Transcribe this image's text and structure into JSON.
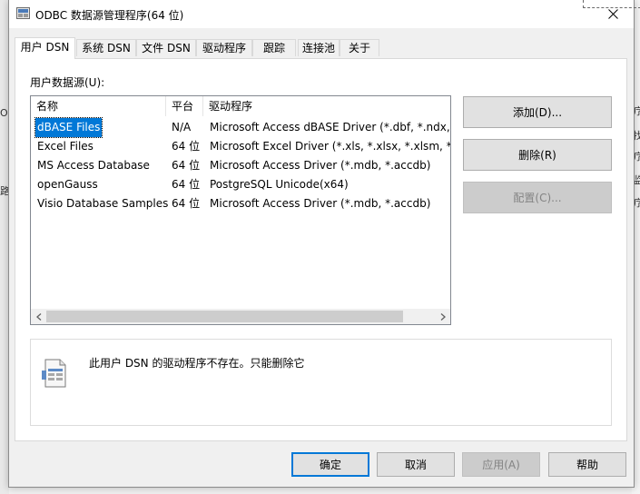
{
  "window": {
    "title": "ODBC 数据源管理程序(64 位)"
  },
  "tabs": [
    {
      "label": "用户 DSN",
      "active": true
    },
    {
      "label": "系统 DSN"
    },
    {
      "label": "文件 DSN"
    },
    {
      "label": "驱动程序"
    },
    {
      "label": "跟踪"
    },
    {
      "label": "连接池"
    },
    {
      "label": "关于"
    }
  ],
  "user_dsn": {
    "section_label": "用户数据源(U):",
    "columns": [
      "名称",
      "平台",
      "驱动程序"
    ],
    "rows": [
      {
        "name": "dBASE Files",
        "platform": "N/A",
        "driver": "Microsoft Access dBASE Driver (*.dbf, *.ndx, *",
        "selected": true
      },
      {
        "name": "Excel Files",
        "platform": "64 位",
        "driver": "Microsoft Excel Driver (*.xls, *.xlsx, *.xlsm, *.xls"
      },
      {
        "name": "MS Access Database",
        "platform": "64 位",
        "driver": "Microsoft Access Driver (*.mdb, *.accdb)"
      },
      {
        "name": "openGauss",
        "platform": "64 位",
        "driver": "PostgreSQL Unicode(x64)"
      },
      {
        "name": "Visio Database Samples",
        "platform": "64 位",
        "driver": "Microsoft Access Driver (*.mdb, *.accdb)"
      }
    ],
    "buttons": {
      "add": "添加(D)...",
      "remove": "删除(R)",
      "configure": "配置(C)..."
    },
    "info_message": "此用户 DSN 的驱动程序不存在。只能删除它"
  },
  "footer": {
    "ok": "确定",
    "cancel": "取消",
    "apply": "应用(A)",
    "help": "帮助"
  },
  "background_fragments": {
    "left_top": "O",
    "left_mid": "路",
    "right_1": "疗",
    "right_2": "找",
    "right_3": "疗",
    "right_4": "监",
    "right_5": "疗"
  },
  "colors": {
    "selection": "#0078d7",
    "default_button_border": "#0078d7",
    "disabled_text": "#838383"
  }
}
